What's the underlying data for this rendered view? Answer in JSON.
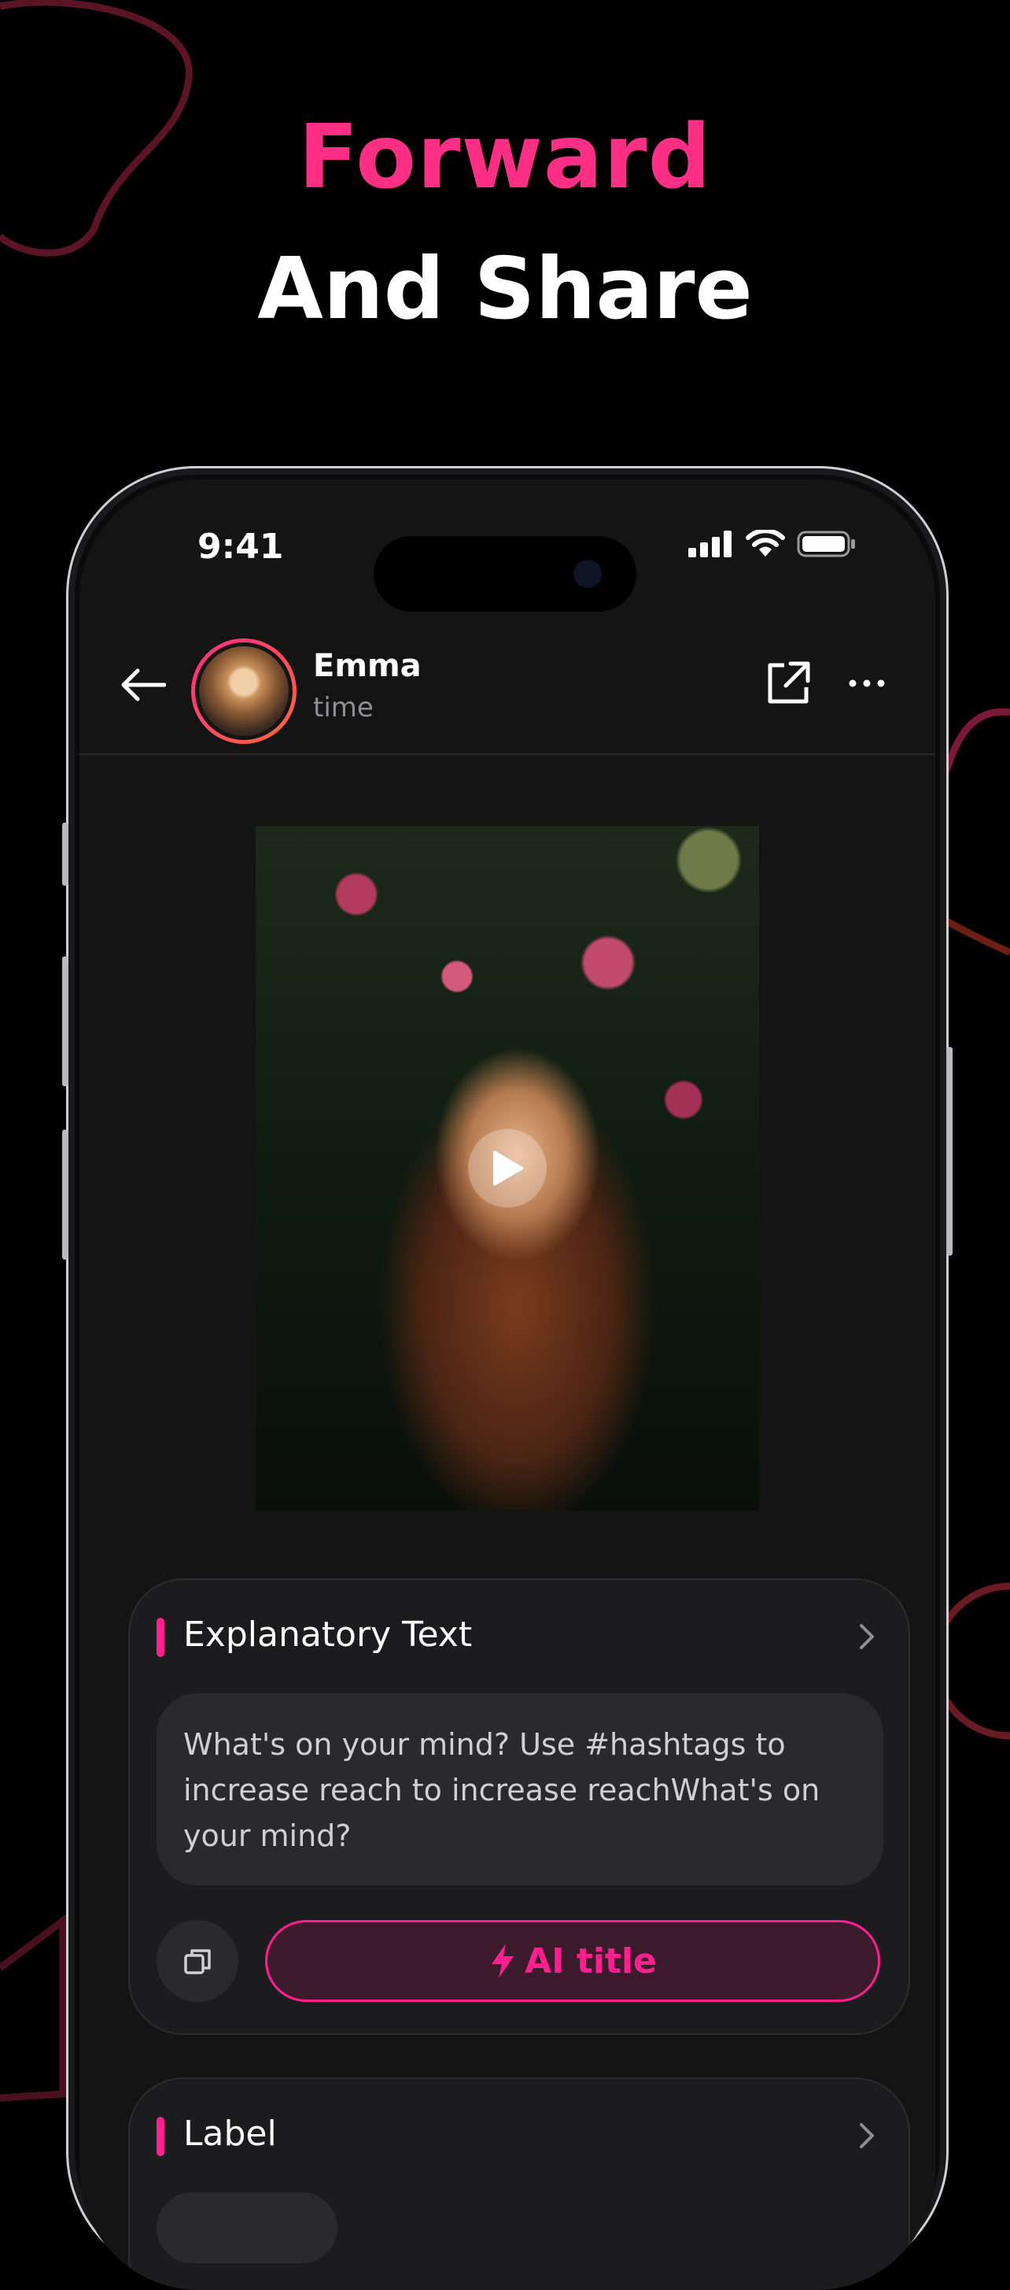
{
  "promo": {
    "line1": "Forward",
    "line2": "And Share",
    "accent_color": "#ff2f86"
  },
  "status_bar": {
    "time": "9:41",
    "icons": [
      "cellular-signal-icon",
      "wifi-icon",
      "battery-icon"
    ]
  },
  "header": {
    "back_icon": "arrow-left-icon",
    "user_name": "Emma",
    "user_subtitle": "time",
    "share_icon": "external-share-icon",
    "more_icon": "ellipsis-icon"
  },
  "media": {
    "play_icon": "play-icon"
  },
  "explanatory_card": {
    "title": "Explanatory Text",
    "body": "What's on your mind? Use #hashtags to increase reach to increase reachWhat's on your mind?",
    "copy_icon": "copy-icon",
    "ai_button_label": "AI title",
    "ai_icon": "lightning-icon"
  },
  "label_card": {
    "title": "Label"
  }
}
